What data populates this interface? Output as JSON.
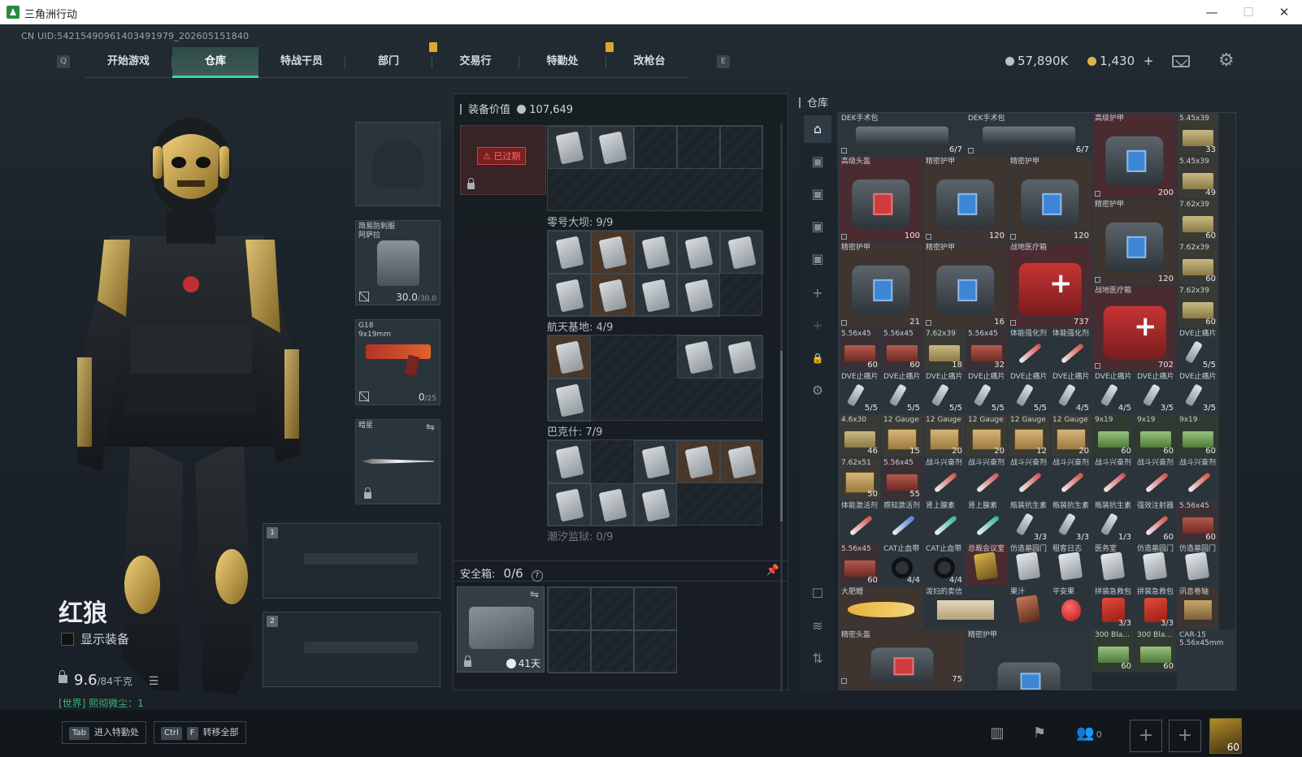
{
  "window": {
    "title": "三角洲行动",
    "minimize": "—",
    "maximize": "☐",
    "close": "✕"
  },
  "uid": "CN UID:542154909614034919‍79_202605151840",
  "nav": {
    "left_key": "Q",
    "right_key": "E",
    "tabs": [
      "开始游戏",
      "仓库",
      "特战干员",
      "部门",
      "交易行",
      "特勤处",
      "改枪台"
    ],
    "active_tab": "仓库"
  },
  "currency": {
    "havoc": "57,890K",
    "coupon": "1,430",
    "plus": "+",
    "havoc_color": "#b9c2c8",
    "coupon_color": "#d9b44a"
  },
  "operator": {
    "name": "红狼",
    "show_equipment": "显示装备",
    "weight": "9.6",
    "weight_max": "/84千克",
    "world_chat": "[世界]  熙彻微尘：1"
  },
  "equipment": {
    "armor": {
      "label": "简易防刺服\n阿萨拉",
      "durability": "30.0",
      "max": "/30.0"
    },
    "weapon": {
      "label": "G18\n9x19mm",
      "ammo": "0",
      "max": "/25"
    },
    "melee": {
      "label": "暗星"
    },
    "slot1": "1",
    "slot2": "2"
  },
  "center": {
    "equip_value_label": "装备价值",
    "equip_value": "107,649",
    "expired": "已过期",
    "maps": [
      {
        "title": "零号大坝: 9/9"
      },
      {
        "title": "航天基地: 4/9"
      },
      {
        "title": "巴克什: 7/9"
      },
      {
        "title": "潮汐监狱: 0/9"
      }
    ],
    "safebox": {
      "label": "安全箱:",
      "count": "0/6",
      "help": "?",
      "days": "41天"
    }
  },
  "stash": {
    "label": "仓库",
    "items": [
      {
        "name": "DEK手术包",
        "count": "6/7"
      },
      {
        "name": "DEK手术包",
        "count": "6/7"
      },
      {
        "name": "高级护甲",
        "count": "200"
      },
      {
        "name": "5.45x39",
        "count": "33"
      },
      {
        "name": "高级头盔",
        "count": "100"
      },
      {
        "name": "精密护甲",
        "count": "120"
      },
      {
        "name": "精密护甲",
        "count": "120"
      },
      {
        "name": "5.45x39",
        "count": "49"
      },
      {
        "name": "精密护甲",
        "count": "120"
      },
      {
        "name": "7.62x39",
        "count": "60"
      },
      {
        "name": "精密护甲",
        "count": "21"
      },
      {
        "name": "精密护甲",
        "count": "16"
      },
      {
        "name": "战地医疗箱",
        "count": "737"
      },
      {
        "name": "7.62x39",
        "count": "60"
      },
      {
        "name": "战地医疗箱",
        "count": "702"
      },
      {
        "name": "7.62x39",
        "count": "60"
      },
      {
        "name": "5.56x45",
        "count": "60"
      },
      {
        "name": "5.56x45",
        "count": "60"
      },
      {
        "name": "7.62x39",
        "count": "18"
      },
      {
        "name": "5.56x45",
        "count": "32"
      },
      {
        "name": "体能强化剂",
        "count": ""
      },
      {
        "name": "体能强化剂",
        "count": ""
      },
      {
        "name": "DVE止痛片",
        "count": "5/5"
      },
      {
        "name": "DVE止痛片",
        "count": "5/5"
      },
      {
        "name": "DVE止痛片",
        "count": "5/5"
      },
      {
        "name": "DVE止痛片",
        "count": "5/5"
      },
      {
        "name": "DVE止痛片",
        "count": "5/5"
      },
      {
        "name": "DVE止痛片",
        "count": "5/5"
      },
      {
        "name": "DVE止痛片",
        "count": "4/5"
      },
      {
        "name": "DVE止痛片",
        "count": "4/5"
      },
      {
        "name": "DVE止痛片",
        "count": "3/5"
      },
      {
        "name": "DVE止痛片",
        "count": "3/5"
      },
      {
        "name": "4.6x30",
        "count": "46"
      },
      {
        "name": "12 Gauge",
        "count": "15"
      },
      {
        "name": "12 Gauge",
        "count": "20"
      },
      {
        "name": "12 Gauge",
        "count": "20"
      },
      {
        "name": "12 Gauge",
        "count": "12"
      },
      {
        "name": "12 Gauge",
        "count": "20"
      },
      {
        "name": "9x19",
        "count": "60"
      },
      {
        "name": "9x19",
        "count": "60"
      },
      {
        "name": "9x19",
        "count": "60"
      },
      {
        "name": "7.62x51",
        "count": "50"
      },
      {
        "name": "5.56x45",
        "count": "55"
      },
      {
        "name": "战斗兴奋剂",
        "count": ""
      },
      {
        "name": "战斗兴奋剂",
        "count": ""
      },
      {
        "name": "战斗兴奋剂",
        "count": ""
      },
      {
        "name": "战斗兴奋剂",
        "count": ""
      },
      {
        "name": "战斗兴奋剂",
        "count": ""
      },
      {
        "name": "战斗兴奋剂",
        "count": ""
      },
      {
        "name": "战斗兴奋剂",
        "count": ""
      },
      {
        "name": "体能激活剂",
        "count": ""
      },
      {
        "name": "感知激活剂",
        "count": ""
      },
      {
        "name": "肾上腺素",
        "count": ""
      },
      {
        "name": "肾上腺素",
        "count": ""
      },
      {
        "name": "瓶装抗生素",
        "count": "3/3"
      },
      {
        "name": "瓶装抗生素",
        "count": "3/3"
      },
      {
        "name": "瓶装抗生素",
        "count": "1/3"
      },
      {
        "name": "强效注射器",
        "count": "60"
      },
      {
        "name": "5.56x45",
        "count": "60"
      },
      {
        "name": "5.56x45",
        "count": "60"
      },
      {
        "name": "CAT止血带",
        "count": "4/4"
      },
      {
        "name": "CAT止血带",
        "count": "4/4"
      },
      {
        "name": "总裁会议室",
        "count": ""
      },
      {
        "name": "仿造墓园门",
        "count": ""
      },
      {
        "name": "租客日志",
        "count": ""
      },
      {
        "name": "医务室",
        "count": ""
      },
      {
        "name": "仿造墓园门",
        "count": ""
      },
      {
        "name": "仿造墓园门",
        "count": ""
      },
      {
        "name": "大肥鲤",
        "count": ""
      },
      {
        "name": "泼妇的卖信",
        "count": ""
      },
      {
        "name": "果汁",
        "count": ""
      },
      {
        "name": "平安果",
        "count": ""
      },
      {
        "name": "拼装急救包",
        "count": "3/3"
      },
      {
        "name": "拼装急救包",
        "count": "3/3"
      },
      {
        "name": "讯息卷轴",
        "count": ""
      },
      {
        "name": "精密头盔",
        "count": "75"
      },
      {
        "name": "精密护甲",
        "count": ""
      },
      {
        "name": "300 Bla...",
        "count": "60"
      },
      {
        "name": "300 Bla...",
        "count": "60"
      },
      {
        "name": "CAR-15\n5.56x45mm",
        "count": ""
      }
    ]
  },
  "bottom": {
    "btn1_key": "Tab",
    "btn1_label": "进入特勤处",
    "btn2_key1": "Ctrl",
    "btn2_key2": "F",
    "btn2_label": "转移全部",
    "friends": "0",
    "avatar_level": "60"
  }
}
